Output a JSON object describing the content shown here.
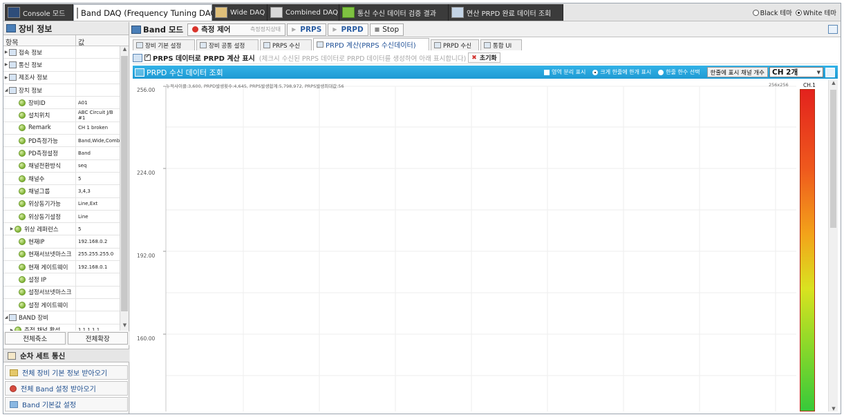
{
  "top_tabs": [
    {
      "label": "Console 모드",
      "icon": "console-icon"
    },
    {
      "label": "Band DAQ (Frequency Tuning DAQ)",
      "icon": "band-daq-icon"
    },
    {
      "label": "Wide DAQ",
      "icon": "wide-daq-icon"
    },
    {
      "label": "Combined DAQ",
      "icon": "combined-daq-icon"
    },
    {
      "label": "통신 수신 데이터 검증 결과",
      "icon": "check-icon"
    },
    {
      "label": "연산 PRPD 완료 데이터 조회",
      "icon": "table-icon"
    }
  ],
  "theme": {
    "black": "Black 테마",
    "white": "White 테마",
    "selected": "white"
  },
  "left_panel": {
    "title": "장비 정보",
    "col_item": "항목",
    "col_value": "값",
    "rows": [
      {
        "key": "접속 정보",
        "value": "",
        "type": "cat"
      },
      {
        "key": "통신 정보",
        "value": "",
        "type": "cat"
      },
      {
        "key": "제조사 정보",
        "value": "",
        "type": "cat"
      },
      {
        "key": "장치 정보",
        "value": "",
        "type": "cat-open"
      },
      {
        "key": "장비ID",
        "value": "A01",
        "type": "item"
      },
      {
        "key": "설치위치",
        "value": "ABC Circuit J/B #1",
        "type": "item"
      },
      {
        "key": "Remark",
        "value": "CH 1 broken",
        "type": "item"
      },
      {
        "key": "PD측정가능",
        "value": "Band,Wide,Combined",
        "type": "item"
      },
      {
        "key": "PD측정설정",
        "value": "Band",
        "type": "item"
      },
      {
        "key": "채널전환방식",
        "value": "seq",
        "type": "item"
      },
      {
        "key": "채널수",
        "value": "5",
        "type": "item"
      },
      {
        "key": "채널그룹",
        "value": "3,4,3",
        "type": "item"
      },
      {
        "key": "위상동기가능",
        "value": "Line,Ext",
        "type": "item"
      },
      {
        "key": "위상동기설정",
        "value": "Line",
        "type": "item"
      },
      {
        "key": "위상 레퍼런스",
        "value": "5",
        "type": "item-arrow"
      },
      {
        "key": "현재IP",
        "value": "192.168.0.2",
        "type": "item"
      },
      {
        "key": "현재서브넷마스크",
        "value": "255.255.255.0",
        "type": "item"
      },
      {
        "key": "현재 게이트웨이",
        "value": "192.168.0.1",
        "type": "item"
      },
      {
        "key": "설정 IP",
        "value": "",
        "type": "item"
      },
      {
        "key": "설정서브넷마스크",
        "value": "",
        "type": "item"
      },
      {
        "key": "설정 게이트웨이",
        "value": "",
        "type": "item"
      },
      {
        "key": "BAND 장비",
        "value": "",
        "type": "cat-open"
      },
      {
        "key": "측정 채널 활성",
        "value": "1,1,1,1,1",
        "type": "item-arrow"
      }
    ],
    "collapse_all": "전체축소",
    "expand_all": "전체확장",
    "seq_title": "순차 세트 통신",
    "seq_buttons": [
      "전체 장비 기본 정보 받아오기",
      "전체 Band 설정 받아오기",
      "Band 기본값 설정"
    ]
  },
  "modebar": {
    "mode": "Band 모드",
    "measure": "측정 제어",
    "measure_state": "측정정지상태",
    "prps": "PRPS",
    "prpd": "PRPD",
    "stop": "Stop"
  },
  "sub_tabs": [
    {
      "label": "장비 기본 설정"
    },
    {
      "label": "장비 공통 설정"
    },
    {
      "label": "PRPS 수신"
    },
    {
      "label": "PRPD 계산(PRPS 수신데이터)",
      "active": true
    },
    {
      "label": "PRPD 수신"
    },
    {
      "label": "통합 UI"
    }
  ],
  "calc_bar": {
    "checkbox_label": "PRPS 데이터로 PRPD 계산 표시",
    "hint": "(체크시 수신된 PRPS 데이터로 PRPD 데이터를 생성하여 아래 표시합니다)",
    "reset": "초기화",
    "checked": true
  },
  "prpd_header": {
    "title": "PRPD 수신 데이터 조회",
    "opt_separate": "영역 분리 표시",
    "opt_all_in_one": "크게 한줄에 한개 표시",
    "opt_select": "한줄 한수 선택",
    "channel_label": "한줄에 표시 채널 개수",
    "channel_value": "CH 2개"
  },
  "plot": {
    "meta": "누적사이클:3,600,  PRPD발생횟수:4,645,  PRPS발생합계:5,798,972,  PRPS발생최대값:56",
    "size": "256x256",
    "channel": "CH.1",
    "y_ticks": [
      "256.00",
      "224.00",
      "192.00",
      "160.00"
    ]
  }
}
